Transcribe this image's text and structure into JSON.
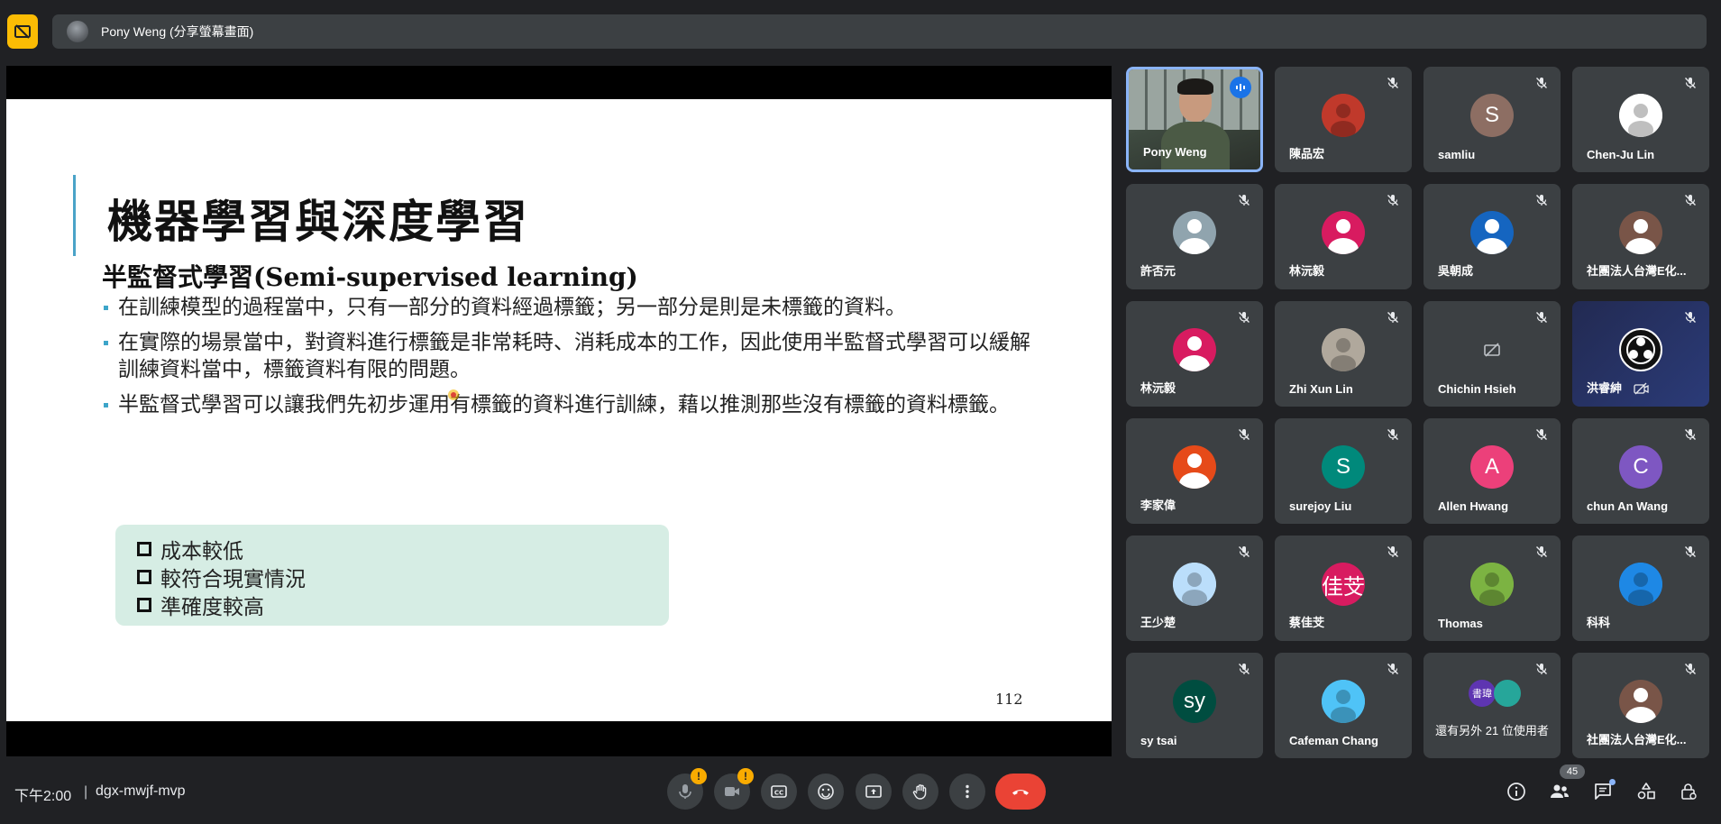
{
  "top": {
    "presenter_label": "Pony Weng (分享螢幕畫面)"
  },
  "slide": {
    "title": "機器學習與深度學習",
    "subtitle": "半監督式學習(Semi-supervised learning)",
    "bullets": [
      "在訓練模型的過程當中，只有一部分的資料經過標籤；另一部分是則是未標籤的資料。",
      "在實際的場景當中，對資料進行標籤是非常耗時、消耗成本的工作，因此使用半監督式學習可以緩解訓練資料當中，標籤資料有限的問題。",
      "半監督式學習可以讓我們先初步運用有標籤的資料進行訓練，藉以推測那些沒有標籤的資料標籤。"
    ],
    "callout": [
      "成本較低",
      "較符合現實情況",
      "準確度較高"
    ],
    "page_number": "112"
  },
  "participants": {
    "tiles": [
      {
        "name": "Pony Weng",
        "avatar": "video-feed",
        "speaking": true
      },
      {
        "name": "陳品宏",
        "avatar": "image-avatar",
        "color": "#c0392b"
      },
      {
        "name": "samliu",
        "letter": "S",
        "color": "#8d6e63"
      },
      {
        "name": "Chen-Ju Lin",
        "avatar": "image-avatar",
        "color": "#ffffff"
      },
      {
        "name": "許否元",
        "avatar": "person-avatar",
        "color": "#90a4ae"
      },
      {
        "name": "林沅毅",
        "avatar": "person-avatar",
        "color": "#d81b60"
      },
      {
        "name": "吳朝成",
        "avatar": "person-avatar",
        "color": "#1565c0"
      },
      {
        "name": "社團法人台灣E化...",
        "avatar": "person-avatar",
        "color": "#795548"
      },
      {
        "name": "林沅毅",
        "avatar": "person-avatar",
        "color": "#d81b60"
      },
      {
        "name": "Zhi Xun Lin",
        "avatar": "image-avatar",
        "color": "#b0a89c"
      },
      {
        "name": "Chichin Hsieh",
        "avatar": "camera-off",
        "color": "#3c4043"
      },
      {
        "name": "洪睿紳",
        "avatar": "obs-logo",
        "color": "#2b3b78",
        "camera_off": true
      },
      {
        "name": "李家偉",
        "avatar": "person-avatar",
        "color": "#e64a19"
      },
      {
        "name": "surejoy Liu",
        "letter": "S",
        "color": "#00897b"
      },
      {
        "name": "Allen Hwang",
        "letter": "A",
        "color": "#ec407a"
      },
      {
        "name": "chun An Wang",
        "letter": "C",
        "color": "#7e57c2"
      },
      {
        "name": "王少楚",
        "avatar": "image-avatar",
        "color": "#bbdefb"
      },
      {
        "name": "蔡佳芠",
        "letter": "佳芠",
        "color": "#d81b60"
      },
      {
        "name": "Thomas",
        "avatar": "image-avatar",
        "color": "#7cb342"
      },
      {
        "name": "科科",
        "avatar": "image-avatar",
        "color": "#1e88e5"
      },
      {
        "name": "sy tsai",
        "letter": "sy",
        "color": "#004d40"
      },
      {
        "name": "Cafeman Chang",
        "avatar": "image-avatar",
        "color": "#4fc3f7"
      },
      {
        "name": "還有另外 21 位使用者",
        "avatar": "more-users",
        "mini_label": "書瑋"
      },
      {
        "name": "社團法人台灣E化...",
        "avatar": "person-avatar",
        "color": "#795548"
      }
    ]
  },
  "bottom": {
    "time": "下午2:00",
    "separator": "|",
    "meeting_code": "dgx-mwjf-mvp",
    "participant_count": "45",
    "warn": "!"
  },
  "colors": {
    "background": "#202124",
    "tile": "#3c4043",
    "end_call": "#ea4335",
    "warning": "#f9ab00",
    "accent": "#8ab4f8"
  }
}
